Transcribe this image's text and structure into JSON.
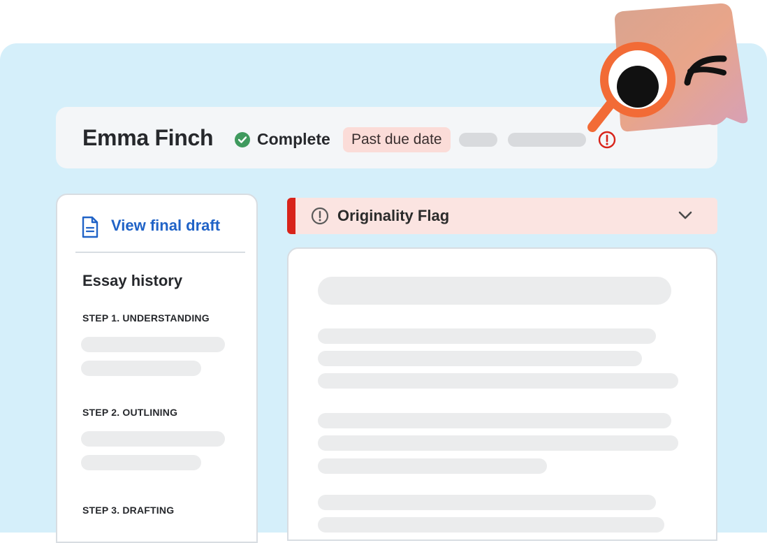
{
  "header": {
    "student_name": "Emma Finch",
    "status": "Complete",
    "due_badge": "Past due date",
    "warning_icon": "exclamation-circle-icon"
  },
  "sidebar": {
    "view_final_draft": "View final draft",
    "history_title": "Essay history",
    "steps": [
      "STEP 1. UNDERSTANDING",
      "STEP 2. OUTLINING",
      "STEP 3. DRAFTING"
    ]
  },
  "flag": {
    "title": "Originality Flag",
    "icon": "exclamation-circle-icon",
    "toggle_icon": "chevron-down-icon"
  },
  "colors": {
    "background": "#d5effa",
    "complete": "#3f9a5e",
    "alert": "#d8231a",
    "link": "#2063c7",
    "badge": "#fbdcd8"
  }
}
